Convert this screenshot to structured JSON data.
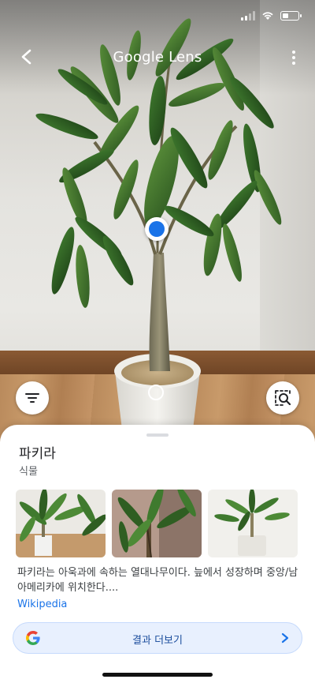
{
  "app": {
    "title": "Google Lens"
  },
  "status_bar": {
    "signal_level": 2,
    "signal_bars": 4,
    "battery_level": 0.4
  },
  "header": {
    "back_icon": "chevron-left-icon",
    "more_icon": "more-vertical-icon"
  },
  "camera": {
    "filter_icon": "filter-icon",
    "search_region_icon": "image-search-icon"
  },
  "result": {
    "title": "파키라",
    "category": "식물",
    "description": "파키라는 아욱과에 속하는 열대나무이다. 늪에서 성장하며 중앙/남아메리카에 위치한다....",
    "source": "Wikipedia",
    "thumbnails": [
      {
        "alt_icon": "plant-photo"
      },
      {
        "alt_icon": "plant-photo"
      },
      {
        "alt_icon": "plant-photo"
      }
    ],
    "more_button": {
      "label": "결과 더보기",
      "icon": "google-g-icon"
    }
  },
  "colors": {
    "accent": "#1a73e8",
    "sheet_button_bg": "#e8f0fe",
    "leaf": "#3d6b2c"
  }
}
